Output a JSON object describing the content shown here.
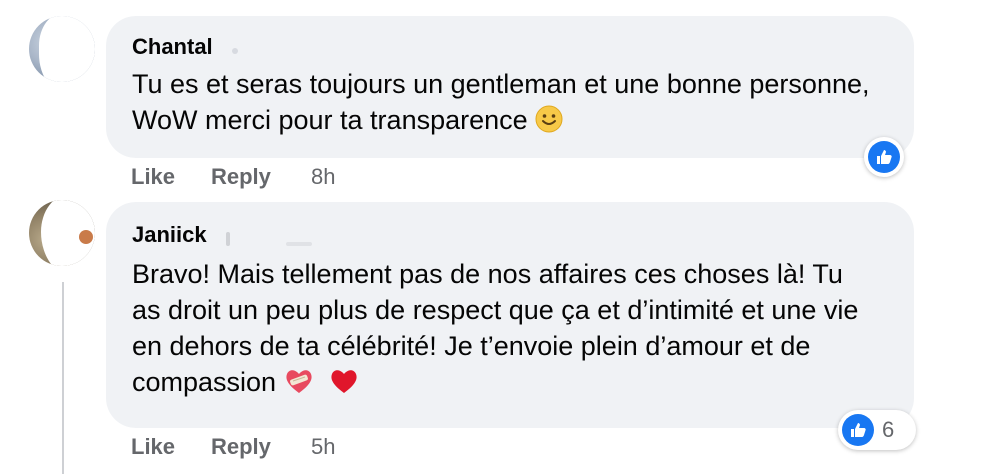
{
  "comments": [
    {
      "author": "Chantal",
      "text": "Tu es et seras toujours un gentleman et une bonne personne, WoW merci pour ta transparence",
      "emoji": "slightly-smiling-face",
      "like_label": "Like",
      "reply_label": "Reply",
      "time": "8h",
      "reaction_icon": "like-icon"
    },
    {
      "author": "Janiick",
      "text": "Bravo! Mais tellement pas de nos affaires ces choses là! Tu as droit un peu plus de respect que ça et d’intimité et une vie en dehors de ta célébrité! Je t’envoie plein d’amour et de compassion",
      "emojis": [
        "mending-heart",
        "red-heart"
      ],
      "like_label": "Like",
      "reply_label": "Reply",
      "time": "5h",
      "reaction_icon": "like-icon",
      "reaction_count": "6"
    }
  ],
  "colors": {
    "bubble": "#f0f2f5",
    "meta_text": "#65676b",
    "like_blue": "#1877f2"
  }
}
